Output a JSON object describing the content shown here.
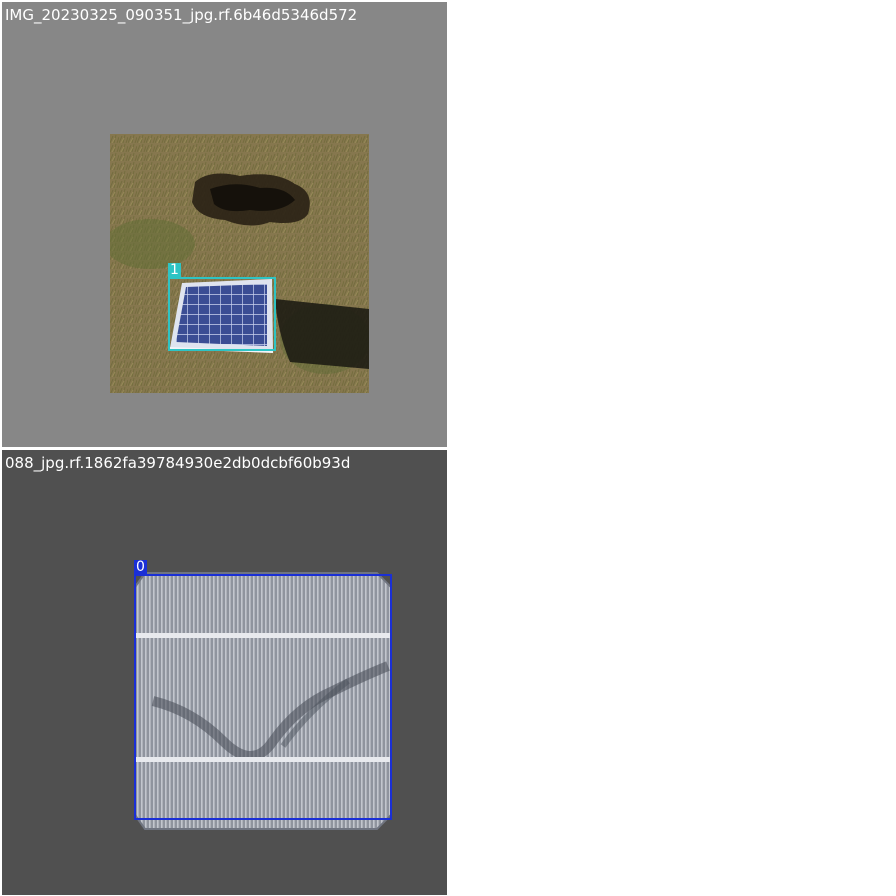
{
  "mosaic": {
    "tiles": [
      {
        "filename": "IMG_20230325_090351_jpg.rf.6b46d5346d572",
        "photo": "solar panel lying on grass near a burnt patch",
        "detections": [
          {
            "class_label": "1",
            "color": "#2ec4c4"
          }
        ],
        "background": "#878787"
      },
      {
        "filename": "088_jpg.rf.1862fa39784930e2db0dcbf60b93d",
        "photo": "electroluminescence image of a monocrystalline solar cell",
        "detections": [
          {
            "class_label": "0",
            "color": "#1a2fd6"
          }
        ],
        "background": "#505050"
      }
    ]
  }
}
